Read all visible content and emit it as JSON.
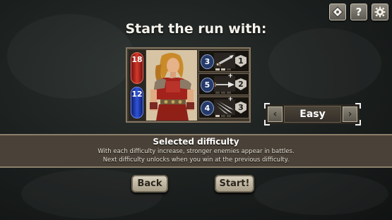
{
  "title": "Start the run with:",
  "toolbar": {
    "icons": [
      "diamond-tag-icon",
      "help-icon",
      "gear-icon"
    ],
    "help_glyph": "?"
  },
  "hero": {
    "health": "18",
    "mana": "12",
    "cards": [
      {
        "cost": "3",
        "value": "1",
        "weapon": "dagger",
        "upgraded": false,
        "pips_filled": 2,
        "pips_total": 3
      },
      {
        "cost": "5",
        "value": "2",
        "weapon": "spear",
        "upgraded": true,
        "pips_filled": 0,
        "pips_total": 3
      },
      {
        "cost": "4",
        "value": "3",
        "weapon": "claw",
        "upgraded": true,
        "pips_filled": 1,
        "pips_total": 3
      }
    ]
  },
  "difficulty": {
    "selected": "Easy",
    "prev_glyph": "‹",
    "next_glyph": "›"
  },
  "info": {
    "heading": "Selected difficulty",
    "line1": "With each difficulty increase, stronger enemies appear in battles.",
    "line2": "Next difficulty unlocks when you win at the previous difficulty."
  },
  "buttons": {
    "back": "Back",
    "start": "Start!"
  },
  "colors": {
    "health_orb": "#c32a1f",
    "mana_orb": "#2c4fd0",
    "band": "#4a4238",
    "button_face": "#d8d0bd"
  }
}
